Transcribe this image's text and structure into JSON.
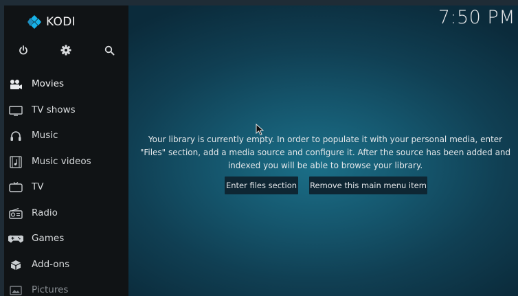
{
  "brand": {
    "name": "KODI"
  },
  "topbar": {
    "clock": "7:50 PM",
    "buttons": [
      {
        "name": "power-icon"
      },
      {
        "name": "gear-icon"
      },
      {
        "name": "search-icon"
      }
    ]
  },
  "sidebar": {
    "items": [
      {
        "label": "Movies",
        "icon": "movie-camera-icon"
      },
      {
        "label": "TV shows",
        "icon": "tv-monitor-icon"
      },
      {
        "label": "Music",
        "icon": "headphones-icon"
      },
      {
        "label": "Music videos",
        "icon": "music-video-icon"
      },
      {
        "label": "TV",
        "icon": "tv-icon"
      },
      {
        "label": "Radio",
        "icon": "radio-icon"
      },
      {
        "label": "Games",
        "icon": "gamepad-icon"
      },
      {
        "label": "Add-ons",
        "icon": "addons-box-icon"
      },
      {
        "label": "Pictures",
        "icon": "picture-icon"
      }
    ]
  },
  "main": {
    "message_line1": "Your library is currently empty. In order to populate it with your personal media, enter",
    "message_line2": "\"Files\" section, add a media source and configure it. After the source has been added and",
    "message_line3": "indexed you will be able to browse your library.",
    "enter_files_label": "Enter files section",
    "remove_item_label": "Remove this main menu item"
  },
  "colors": {
    "accent": "#1b6f88",
    "sidebar_bg": "#101315",
    "button_bg": "#0e2633",
    "logo_blue": "#17b2e8"
  }
}
